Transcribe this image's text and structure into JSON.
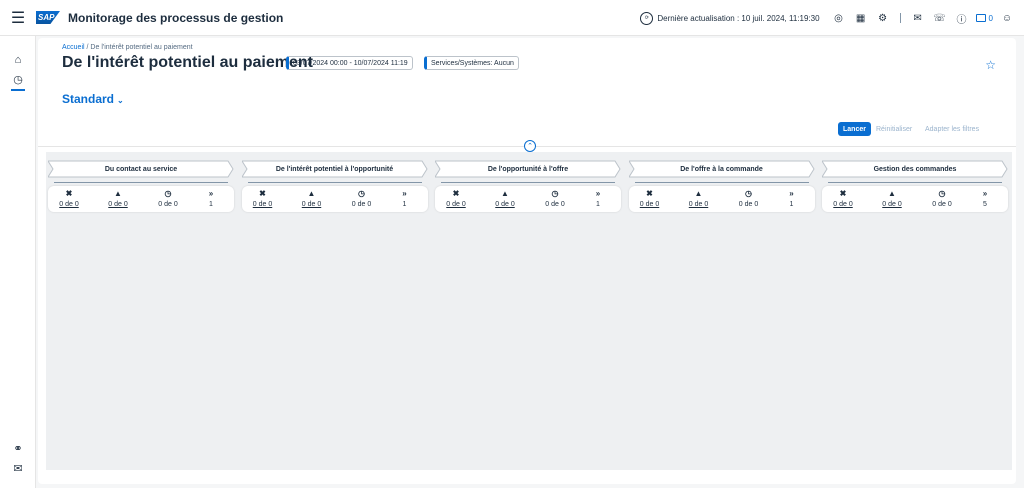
{
  "shell": {
    "app_title": "Monitorage des processus de gestion",
    "logo_text": "SAP",
    "refresh_text": "Dernière actualisation : 10 juil. 2024, 11:19:30",
    "notification_count": "0"
  },
  "page": {
    "breadcrumb_home": "Accueil",
    "breadcrumb_sep": " / ",
    "breadcrumb_current": "De l'intérêt potentiel au paiement",
    "title": "De l'intérêt potentiel au paiement",
    "chip_date": "03/07/2024 00:00 - 10/07/2024 11:19",
    "chip_services": "Services/Systèmes: Aucun",
    "variant": "Standard"
  },
  "filterbar": {
    "go_label": "Lancer",
    "reset_label": "Réinitialiser",
    "adapt_label": "Adapter les filtres"
  },
  "stages": [
    {
      "label": "Du contact au service",
      "errors": "0 de 0",
      "warnings": "0 de 0",
      "ok": "0 de 0",
      "total": "1"
    },
    {
      "label": "De l'intérêt potentiel à l'opportunité",
      "errors": "0 de 0",
      "warnings": "0 de 0",
      "ok": "0 de 0",
      "total": "1"
    },
    {
      "label": "De l'opportunité à l'offre",
      "errors": "0 de 0",
      "warnings": "0 de 0",
      "ok": "0 de 0",
      "total": "1"
    },
    {
      "label": "De l'offre à la commande",
      "errors": "0 de 0",
      "warnings": "0 de 0",
      "ok": "0 de 0",
      "total": "1"
    },
    {
      "label": "Gestion des commandes",
      "errors": "0 de 0",
      "warnings": "0 de 0",
      "ok": "0 de 0",
      "total": "5"
    }
  ],
  "colors": {
    "accent": "#0a6ed1",
    "text": "#1d2d3e",
    "background": "#f5f6f7"
  }
}
